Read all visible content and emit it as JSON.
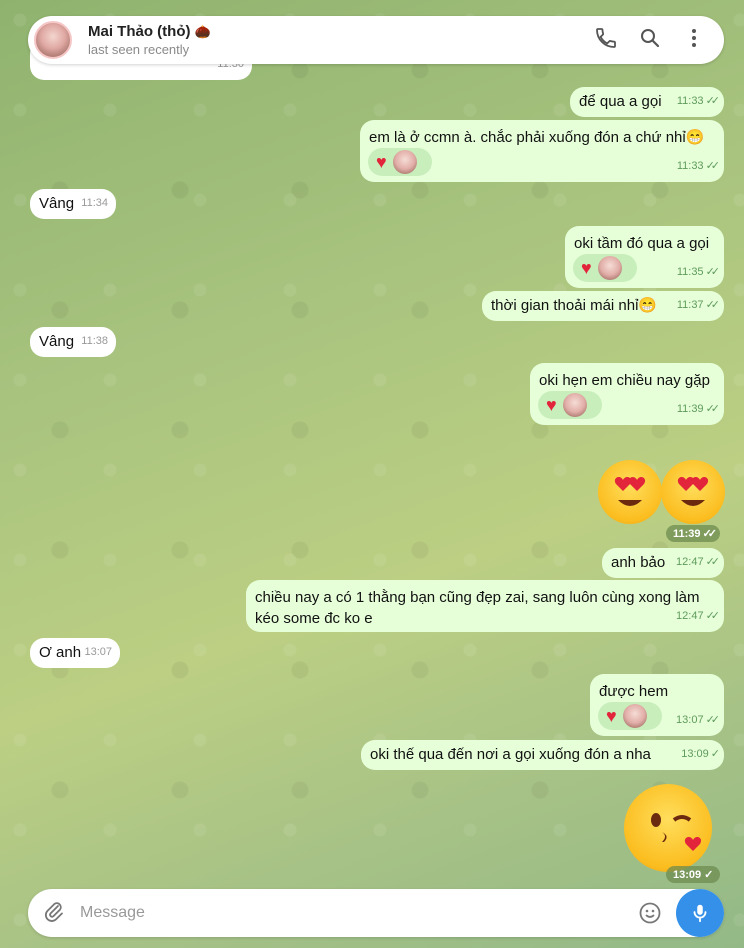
{
  "header": {
    "name": "Mai Thảo (thỏ)",
    "status": "last seen recently"
  },
  "top_fragment": {
    "time": "11:30"
  },
  "messages": [
    {
      "text": "để qua a gọi",
      "time": "11:33"
    },
    {
      "text": "em là ở ccmn à. chắc phải xuống đón a chứ nhỉ😁",
      "time": "11:33"
    },
    {
      "text": "Vâng",
      "time": "11:34"
    },
    {
      "text": "oki tầm đó qua a gọi",
      "time": "11:35"
    },
    {
      "text": "thời gian thoải mái nhỉ😁",
      "time": "11:37"
    },
    {
      "text": "Vâng",
      "time": "11:38"
    },
    {
      "text": "oki hẹn em chiều nay gặp",
      "time": "11:39"
    },
    {
      "text": "",
      "time": "11:39"
    },
    {
      "text": "anh bảo",
      "time": "12:47"
    },
    {
      "text": "chiều nay a có 1 thằng bạn cũng đẹp zai, sang luôn cùng xong làm kéo some đc ko e",
      "time": "12:47"
    },
    {
      "text": "Ơ anh",
      "time": "13:07"
    },
    {
      "text": "được hem",
      "time": "13:07"
    },
    {
      "text": "oki thế qua đến nơi a gọi xuống đón a nha",
      "time": "13:09"
    },
    {
      "text": "",
      "time": "13:09"
    }
  ],
  "input": {
    "placeholder": "Message"
  },
  "colors": {
    "outgoing": "#e6ffd9",
    "incoming": "#ffffff",
    "accent": "#3490e8"
  }
}
